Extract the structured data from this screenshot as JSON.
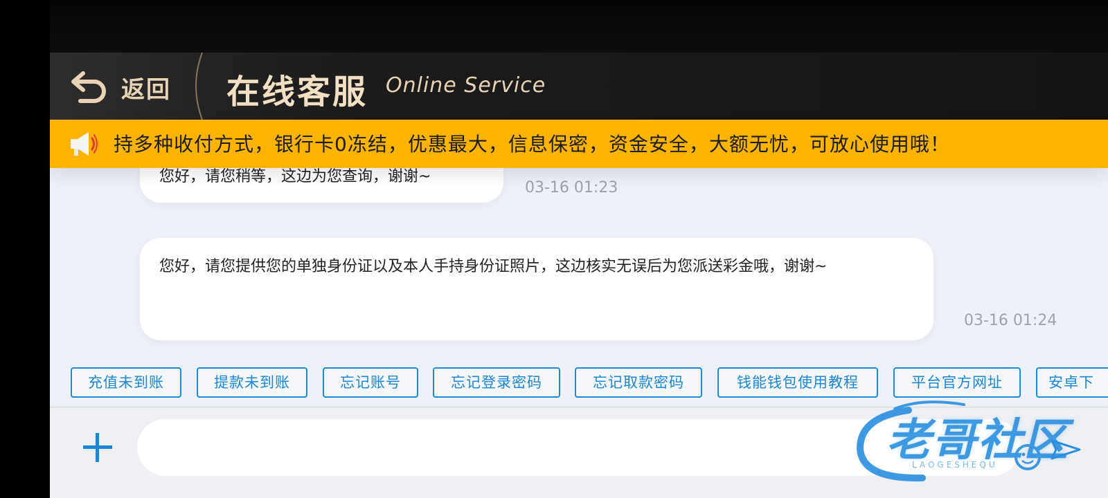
{
  "header": {
    "back_label": "返回",
    "title_cn": "在线客服",
    "title_en": "Online Service",
    "back_icon": "back-arrow-icon"
  },
  "notice": {
    "icon": "megaphone-icon",
    "text": "持多种收付方式，银行卡0冻结，优惠最大，信息保密，资金安全，大额无忧，可放心使用哦！"
  },
  "messages": [
    {
      "text": "您好，请您稍等，这边为您查询，谢谢~",
      "time": "03-16 01:23"
    },
    {
      "text": "您好，请您提供您的单独身份证以及本人手持身份证照片，这边核实无误后为您派送彩金哦，谢谢~",
      "time": "03-16 01:24"
    }
  ],
  "quick_replies": [
    "充值未到账",
    "提款未到账",
    "忘记账号",
    "忘记登录密码",
    "忘记取款密码",
    "钱能钱包使用教程",
    "平台官方网址",
    "安卓下"
  ],
  "input": {
    "placeholder": "",
    "plus_icon": "plus-icon",
    "send_icon": "send-icon"
  },
  "watermark": {
    "text": "老哥社区",
    "sub": "LAOGESHEQU"
  },
  "colors": {
    "header_bg": "#1b1b1b",
    "header_text": "#e8d3b5",
    "notice_bg": "#fdb400",
    "accent_blue": "#1b8ad8",
    "chat_bg": "#eef2f8",
    "timestamp": "#9aa2ad"
  }
}
